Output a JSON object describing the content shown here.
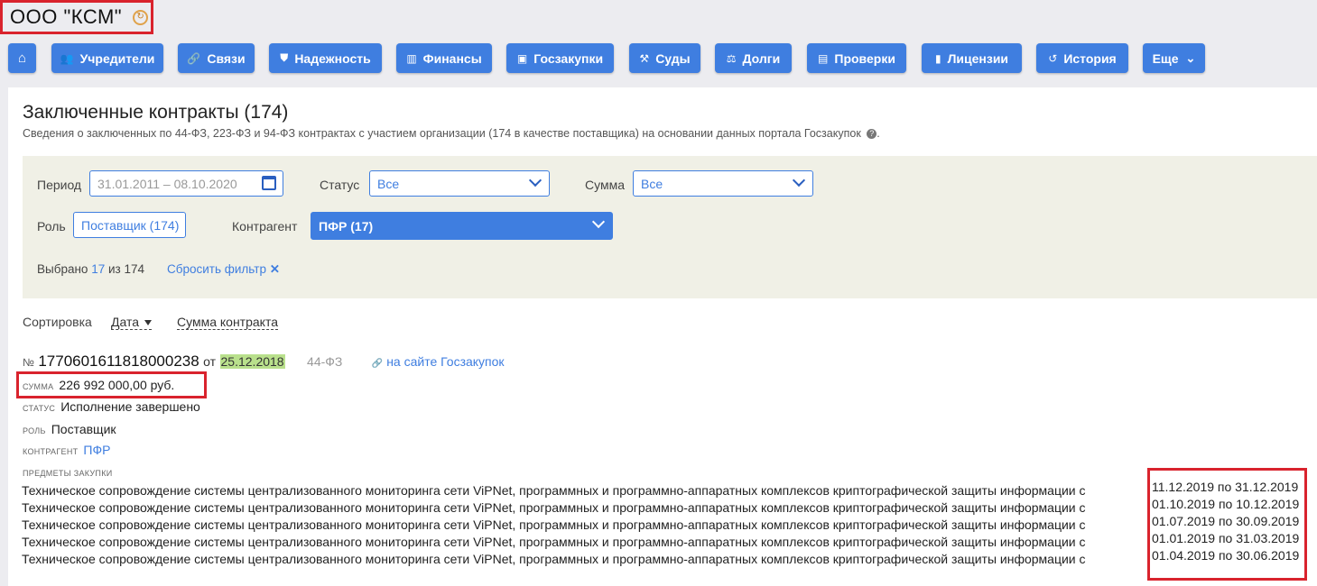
{
  "company": {
    "name": "ООО \"КСМ\"",
    "icon": "rotate-icon"
  },
  "nav": [
    {
      "label": "",
      "icon": "home-icon",
      "glyph": "⌂"
    },
    {
      "label": "Учредители",
      "icon": "users-icon",
      "glyph": "👥"
    },
    {
      "label": "Связи",
      "icon": "link-icon",
      "glyph": "🔗"
    },
    {
      "label": "Надежность",
      "icon": "shield-icon",
      "glyph": "⛊"
    },
    {
      "label": "Финансы",
      "icon": "chart-icon",
      "glyph": "▥"
    },
    {
      "label": "Госзакупки",
      "icon": "card-icon",
      "glyph": "▣"
    },
    {
      "label": "Суды",
      "icon": "gavel-icon",
      "glyph": "⚒"
    },
    {
      "label": "Долги",
      "icon": "scales-icon",
      "glyph": "⚖"
    },
    {
      "label": "Проверки",
      "icon": "clipboard-icon",
      "glyph": "▤"
    },
    {
      "label": "Лицензии",
      "icon": "book-icon",
      "glyph": "▮"
    },
    {
      "label": "История",
      "icon": "history-icon",
      "glyph": "↺"
    },
    {
      "label": "Еще",
      "icon": "chevron-down-icon",
      "glyph": "⌄"
    }
  ],
  "page": {
    "title": "Заключенные контракты (174)",
    "subtitle": "Сведения о заключенных по 44-ФЗ, 223-ФЗ и 94-ФЗ контрактах с участием организации (174 в качестве поставщика) на основании данных портала Госзакупок"
  },
  "filters": {
    "period_label": "Период",
    "period_value": "31.01.2011 – 08.10.2020",
    "status_label": "Статус",
    "status_value": "Все",
    "sum_label": "Сумма",
    "sum_value": "Все",
    "role_label": "Роль",
    "role_value": "Поставщик (174)",
    "counterparty_label": "Контрагент",
    "counterparty_value": "ПФР (17)",
    "selected_prefix": "Выбрано",
    "selected_count": "17",
    "selected_of": "из 174",
    "reset_label": "Сбросить фильтр",
    "reset_icon": "close-icon"
  },
  "sort": {
    "label": "Сортировка",
    "options": [
      "Дата",
      "Сумма контракта"
    ]
  },
  "contract": {
    "no_label": "№",
    "number": "1770601611818000238",
    "from_label": "от",
    "date": "25.12.2018",
    "law": "44-ФЗ",
    "site_link": "на сайте Госзакупок",
    "sum_label": "сумма",
    "sum_value": "226 992 000,00 руб.",
    "status_label": "статус",
    "status_value": "Исполнение завершено",
    "role_label": "роль",
    "role_value": "Поставщик",
    "counterparty_label": "контрагент",
    "counterparty_value": "ПФР",
    "items_label": "предметы закупки",
    "items": [
      {
        "text": "Техническое сопровождение системы централизованного мониторинга сети ViPNet, программных и программно-аппаратных комплексов криптографической защиты информации с",
        "period": "11.12.2019 по 31.12.2019"
      },
      {
        "text": "Техническое сопровождение системы централизованного мониторинга сети ViPNet, программных и программно-аппаратных комплексов криптографической защиты информации с",
        "period": "01.10.2019 по 10.12.2019"
      },
      {
        "text": "Техническое сопровождение системы централизованного мониторинга сети ViPNet, программных и программно-аппаратных комплексов криптографической защиты информации с",
        "period": "01.07.2019 по 30.09.2019"
      },
      {
        "text": "Техническое сопровождение системы централизованного мониторинга сети ViPNet, программных и программно-аппаратных комплексов криптографической защиты информации с",
        "period": "01.01.2019 по 31.03.2019"
      },
      {
        "text": "Техническое сопровождение системы централизованного мониторинга сети ViPNet, программных и программно-аппаратных комплексов криптографической защиты информации с",
        "period": "01.04.2019 по 30.06.2019"
      }
    ]
  },
  "colors": {
    "accent": "#3f7ee0",
    "highlight": "#d9232d",
    "filter_bg": "#f0f0e6",
    "date_bg": "#b9e08c"
  }
}
